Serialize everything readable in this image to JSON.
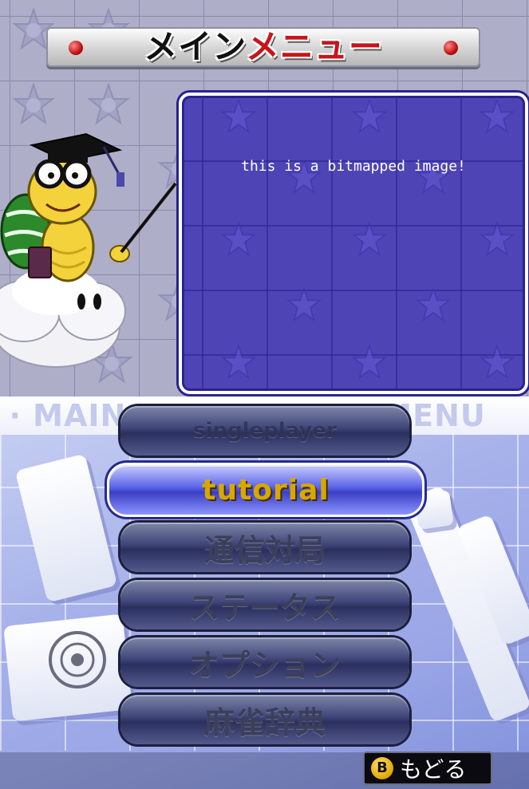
{
  "title": {
    "part1": "メイン",
    "part2": "メニュー"
  },
  "message_panel": {
    "text": "this is a bitmapped image!"
  },
  "marquee": {
    "text": "•  · MAIN MENU  ·  MAIN MENU"
  },
  "menu": {
    "items": [
      {
        "label": "singleplayer",
        "state": "disabled"
      },
      {
        "label": "tutorial",
        "state": "selected"
      },
      {
        "label": "通信対局",
        "state": "normal"
      },
      {
        "label": "ステータス",
        "state": "normal"
      },
      {
        "label": "オプション",
        "state": "normal"
      },
      {
        "label": "麻雀辞典",
        "state": "normal"
      }
    ]
  },
  "back_button": {
    "key": "B",
    "label": "もどる"
  },
  "colors": {
    "title_accent": "#c8141a",
    "panel": "#4e44b6",
    "selected_button": "#3a40c4",
    "selected_text": "#d6a800"
  },
  "icons": {
    "banner_dots": "red-dot-icon",
    "background_pattern": "star-icon",
    "character": "lakitu-professor-icon",
    "back_key": "b-button-icon"
  }
}
